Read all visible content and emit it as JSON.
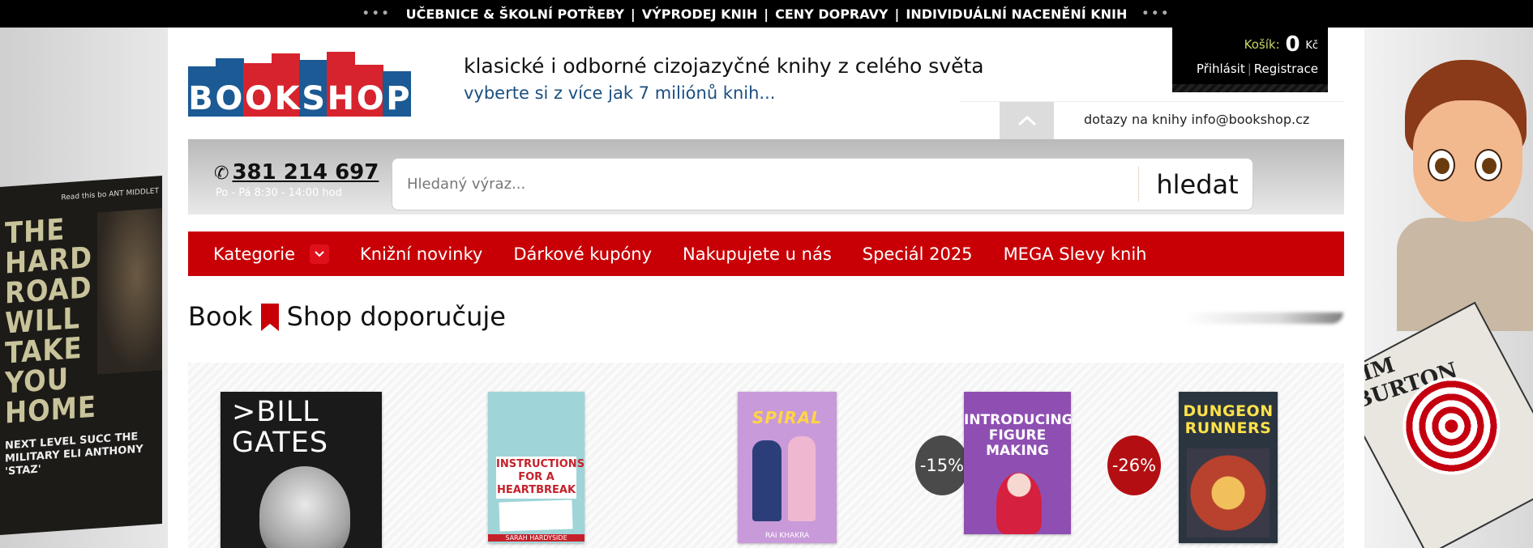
{
  "topbar": {
    "dots_left": "•••",
    "dots_right": "•••",
    "links": [
      "UČEBNICE & ŠKOLNÍ POTŘEBY",
      "VÝPRODEJ KNIH",
      "CENY DOPRAVY",
      "INDIVIDUÁLNÍ NACENĚNÍ KNIH"
    ],
    "separator": "|"
  },
  "header": {
    "logo_text": [
      "B",
      "O",
      "O",
      "K",
      "S",
      "H",
      "O",
      "P"
    ],
    "tagline": "klasické i odborné cizojazyčné knihy z celého světa",
    "subtagline": "vyberte si z více jak 7 miliónů knih...",
    "inquiry": "dotazy na knihy info@bookshop.cz"
  },
  "account": {
    "cart_label": "Košík:",
    "cart_value": "0",
    "cart_currency": "Kč",
    "login": "Přihlásit",
    "register": "Registrace",
    "separator": "|"
  },
  "contact": {
    "phone": "381 214 697",
    "hours": "Po - Pá 8:30 - 14:00 hod"
  },
  "search": {
    "placeholder": "Hledaný výraz...",
    "button": "hledat"
  },
  "nav": {
    "items": [
      "Kategorie",
      "Knižní novinky",
      "Dárkové kupóny",
      "Nakupujete u nás",
      "Speciál 2025",
      "MEGA Slevy knih"
    ]
  },
  "recommend": {
    "title_part1": "Book",
    "title_part2": "Shop doporučuje"
  },
  "products": [
    {
      "cover_text": ">BILL GATES",
      "discount": null
    },
    {
      "cover_text": "INSTRUCTIONS FOR A HEARTBREAK",
      "author": "SARAH HARDYSIDE",
      "discount": null
    },
    {
      "cover_text": "SPIRAL",
      "author": "RAI KHAKRA",
      "discount": null
    },
    {
      "cover_text": "INTRODUCING FIGURE MAKING",
      "discount": "-15%"
    },
    {
      "cover_text": "DUNGEON RUNNERS",
      "discount": "-26%"
    }
  ],
  "side_ads": {
    "left_book": [
      "THE",
      "HARD",
      "ROAD",
      "WILL",
      "TAKE",
      "YOU",
      "HOME"
    ],
    "left_small": "NEXT LEVEL SUCC THE MILITARY ELI ANTHONY 'STAZ'",
    "left_readthis": "Read this bo ANT MIDDLET",
    "right_book": "TIM BURTON"
  },
  "colors": {
    "brand_red": "#c80006",
    "brand_blue": "#1b5a94",
    "discount_dark": "#4a4a4a",
    "discount_red": "#b30f12"
  }
}
